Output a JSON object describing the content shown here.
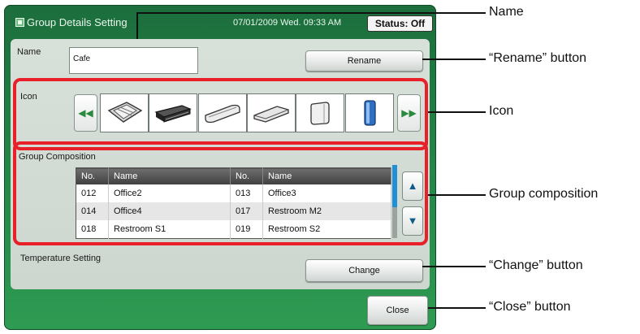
{
  "titlebar": {
    "title": "Group Details Setting",
    "datetime": "07/01/2009 Wed. 09:33 AM",
    "status": "Status: Off"
  },
  "name_section": {
    "label": "Name",
    "value": "Cafe",
    "rename_label": "Rename"
  },
  "icon_section": {
    "label": "Icon",
    "icons": [
      "ceiling-cassette-icon",
      "ceiling-concealed-icon",
      "wall-mounted-icon",
      "ceiling-suspended-icon",
      "floor-standing-icon",
      "tower-icon"
    ]
  },
  "group_section": {
    "label": "Group Composition",
    "headers": [
      "No.",
      "Name",
      "No.",
      "Name"
    ],
    "rows": [
      [
        "012",
        "Office2",
        "013",
        "Office3"
      ],
      [
        "014",
        "Office4",
        "017",
        "Restroom M2"
      ],
      [
        "018",
        "Restroom S1",
        "019",
        "Restroom S2"
      ]
    ],
    "scroll_up": "▲",
    "scroll_down": "▼"
  },
  "temperature_section": {
    "label": "Temperature Setting",
    "change_label": "Change"
  },
  "close_label": "Close",
  "callouts": {
    "name": "Name",
    "rename": "“Rename” button",
    "icon": "Icon",
    "group": "Group composition",
    "change": "“Change” button",
    "close": "“Close” button"
  },
  "colors": {
    "screen_green": "#258a4a",
    "highlight_red": "#e8202a"
  }
}
